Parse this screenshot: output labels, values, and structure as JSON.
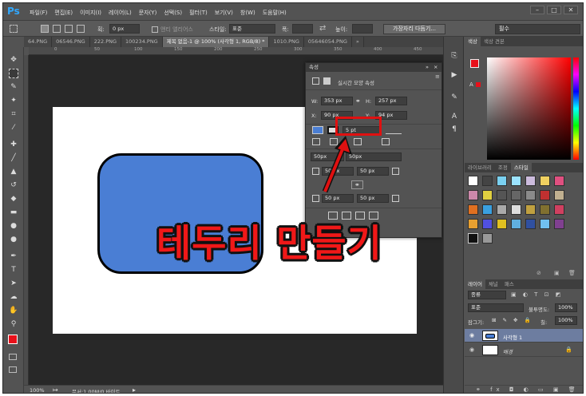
{
  "app": {
    "logo": "Ps"
  },
  "menu": [
    "파일(F)",
    "편집(E)",
    "이미지(I)",
    "레이어(L)",
    "문자(Y)",
    "선택(S)",
    "필터(T)",
    "보기(V)",
    "창(W)",
    "도움말(H)"
  ],
  "window_controls": {
    "minimize": "–",
    "maximize": "□",
    "close": "✕"
  },
  "options_bar": {
    "fill_label": "칠:",
    "stroke_label": "획:",
    "stroke_value": "0 px",
    "antialias_label": "앤티 앨리어스",
    "style_label": "스타일:",
    "style_value": "표준",
    "width_label": "폭:",
    "height_label": "높이:",
    "refine_button": "가장자리 다듬기...",
    "workspace": "필수"
  },
  "tabs": [
    "64.PNG",
    "06546.PNG",
    "222.PNG",
    "100234.PNG",
    "제목 없음-1 @ 100% (사각형 1, RGB/8) *",
    "1010.PNG",
    "05646054.PNG",
    "»"
  ],
  "ruler_numbers": [
    "0",
    "50",
    "100",
    "150",
    "200",
    "250",
    "300",
    "350",
    "400",
    "450"
  ],
  "status": {
    "zoom": "100%",
    "doc": "문서:1.00M/0 바이트"
  },
  "properties": {
    "panel_title": "속성",
    "section_title": "실시간 모양 속성",
    "w_label": "W:",
    "w_value": "353 px",
    "h_label": "H:",
    "h_value": "257 px",
    "x_label": "X:",
    "x_value": "90 px",
    "y_label": "Y:",
    "y_value": "94 px",
    "stroke_width": "5 pt",
    "corner_all": "50px",
    "corner_all_right": "50px",
    "corner_tl": "50 px",
    "corner_tr": "50 px",
    "corner_bl": "50 px",
    "corner_br": "50 px"
  },
  "color_panel": {
    "tabs": [
      "색상",
      "색상 견본"
    ],
    "fg": "#e8101a",
    "bg": "#ff99dd"
  },
  "styles_panel": {
    "tabs": [
      "라이브러리",
      "조정",
      "스타일"
    ]
  },
  "layers_panel": {
    "tabs": [
      "레이어",
      "채널",
      "패스"
    ],
    "filter_label": "종류",
    "blend_mode": "표준",
    "opacity_label": "불투명도:",
    "opacity_value": "100%",
    "lock_label": "잠그기:",
    "fill_label": "칠:",
    "fill_value": "100%",
    "layers": [
      {
        "name": "사각형 1"
      },
      {
        "name": "배경"
      }
    ]
  },
  "annotation": {
    "text": "테두리 만들기"
  },
  "colors": {
    "shape_fill": "#4a7ed4",
    "annotation": "#f01818",
    "accent": "#31a8ff"
  }
}
